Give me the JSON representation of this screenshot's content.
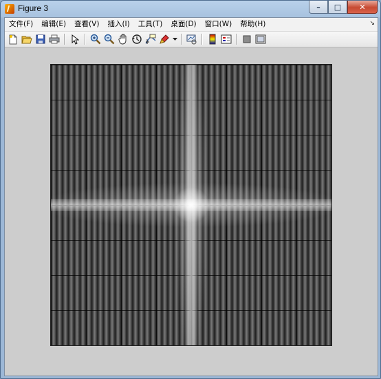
{
  "window": {
    "title": "Figure 3",
    "controls": {
      "minimize": "–",
      "maximize": "□",
      "close": "✕"
    }
  },
  "menubar": {
    "items": [
      {
        "label": "文件(F)"
      },
      {
        "label": "编辑(E)"
      },
      {
        "label": "查看(V)"
      },
      {
        "label": "插入(I)"
      },
      {
        "label": "工具(T)"
      },
      {
        "label": "桌面(D)"
      },
      {
        "label": "窗口(W)"
      },
      {
        "label": "帮助(H)"
      }
    ],
    "overflow_arrow": "↘"
  },
  "toolbar": {
    "buttons": [
      {
        "icon": "new-figure-icon"
      },
      {
        "icon": "open-file-icon"
      },
      {
        "icon": "save-icon"
      },
      {
        "icon": "print-icon"
      },
      {
        "icon": "edit-plot-arrow-icon"
      },
      {
        "icon": "zoom-in-icon"
      },
      {
        "icon": "zoom-out-icon"
      },
      {
        "icon": "pan-hand-icon"
      },
      {
        "icon": "rotate-3d-icon"
      },
      {
        "icon": "data-cursor-icon"
      },
      {
        "icon": "brush-icon"
      },
      {
        "icon": "link-plot-icon"
      },
      {
        "icon": "colorbar-icon"
      },
      {
        "icon": "legend-icon"
      },
      {
        "icon": "hide-plot-tools-icon"
      },
      {
        "icon": "show-plot-tools-icon"
      }
    ]
  },
  "colors": {
    "titlebar": "#b9d1ea",
    "client_bg": "#cdcdcd",
    "close_button": "#c74a32"
  }
}
